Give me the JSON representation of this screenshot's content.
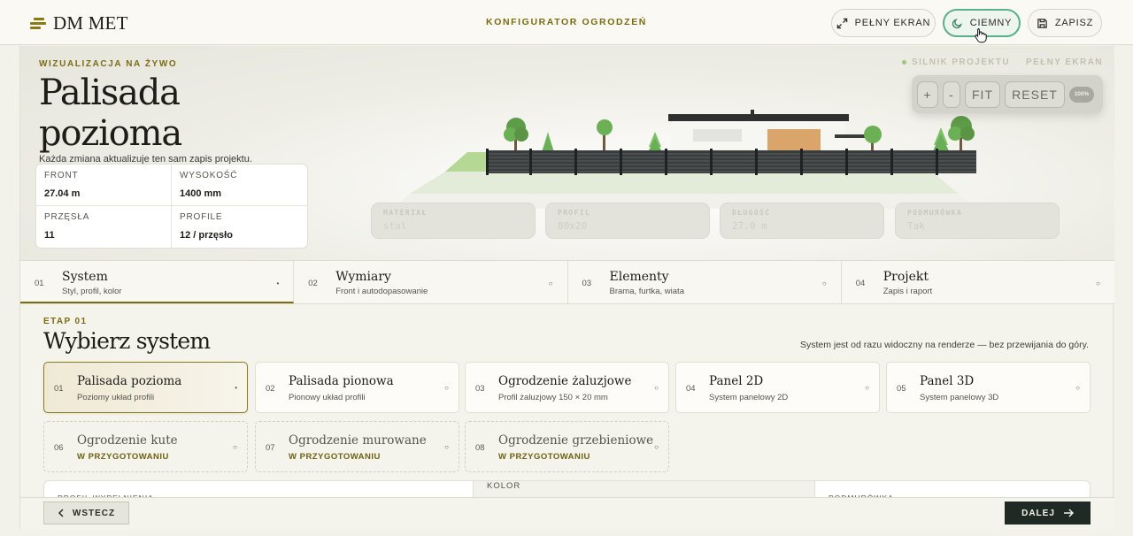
{
  "brand": {
    "name": "DM MET"
  },
  "header": {
    "title": "KONFIGURATOR OGRODZEŃ",
    "buttons": {
      "fullscreen": "PEŁNY EKRAN",
      "dark": "CIEMNY",
      "save": "ZAPISZ"
    }
  },
  "hero": {
    "kicker": "WIZUALIZACJA NA ŻYWO",
    "title_line1": "Palisada",
    "title_line2": "pozioma",
    "subtitle": "Każda zmiana aktualizuje ten sam zapis projektu.",
    "stats": [
      {
        "label": "FRONT",
        "value": "27.04 m"
      },
      {
        "label": "WYSOKOŚĆ",
        "value": "1400 mm"
      },
      {
        "label": "PRZĘSŁA",
        "value": "11"
      },
      {
        "label": "PROFILE",
        "value": "12 / przęsło"
      }
    ]
  },
  "viewer": {
    "engine_label": "SILNIK PROJEKTU",
    "fullscreen_label": "PEŁNY EKRAN",
    "controls": {
      "zoom_in": "+",
      "zoom_out": "-",
      "fit": "FIT",
      "reset": "RESET",
      "zoom_level": "100%"
    },
    "info_cards": [
      {
        "label": "MATERIAŁ",
        "value": "stal"
      },
      {
        "label": "PROFIL",
        "value": "80x20"
      },
      {
        "label": "DŁUGOŚĆ",
        "value": "27.0 m"
      },
      {
        "label": "PODMURÓWKA",
        "value": "Tak"
      }
    ]
  },
  "steps": [
    {
      "num": "01",
      "title": "System",
      "subtitle": "Styl, profil, kolor",
      "status": "•"
    },
    {
      "num": "02",
      "title": "Wymiary",
      "subtitle": "Front i autodopasowanie",
      "status": "○"
    },
    {
      "num": "03",
      "title": "Elementy",
      "subtitle": "Brama, furtka, wiata",
      "status": "○"
    },
    {
      "num": "04",
      "title": "Projekt",
      "subtitle": "Zapis i raport",
      "status": "○"
    }
  ],
  "stage": {
    "kicker": "ETAP 01",
    "title": "Wybierz system",
    "note": "System jest od razu widoczny na renderze — bez przewijania do góry."
  },
  "systems": [
    {
      "num": "01",
      "title": "Palisada pozioma",
      "subtitle": "Poziomy układ profili",
      "status": "•"
    },
    {
      "num": "02",
      "title": "Palisada pionowa",
      "subtitle": "Pionowy układ profili",
      "status": "○"
    },
    {
      "num": "03",
      "title": "Ogrodzenie żaluzjowe",
      "subtitle": "Profil żaluzjowy 150 × 20 mm",
      "status": "○"
    },
    {
      "num": "04",
      "title": "Panel 2D",
      "subtitle": "System panelowy 2D",
      "status": "○"
    },
    {
      "num": "05",
      "title": "Panel 3D",
      "subtitle": "System panelowy 3D",
      "status": "○"
    },
    {
      "num": "06",
      "title": "Ogrodzenie kute",
      "subtitle": "W PRZYGOTOWANIU",
      "status": "○"
    },
    {
      "num": "07",
      "title": "Ogrodzenie murowane",
      "subtitle": "W PRZYGOTOWANIU",
      "status": "○"
    },
    {
      "num": "08",
      "title": "Ogrodzenie grzebieniowe",
      "subtitle": "W PRZYGOTOWANIU",
      "status": "○"
    }
  ],
  "panels": {
    "profile": "PROFIL WYPEŁNIENIA",
    "color": "KOLOR",
    "base": "PODMURÓWKA"
  },
  "footer": {
    "back": "WSTECZ",
    "next": "DALEJ"
  },
  "colors": {
    "accent": "#7a6c12",
    "active_toggle": "#5ab08a",
    "primary_button": "#1f2a24"
  }
}
